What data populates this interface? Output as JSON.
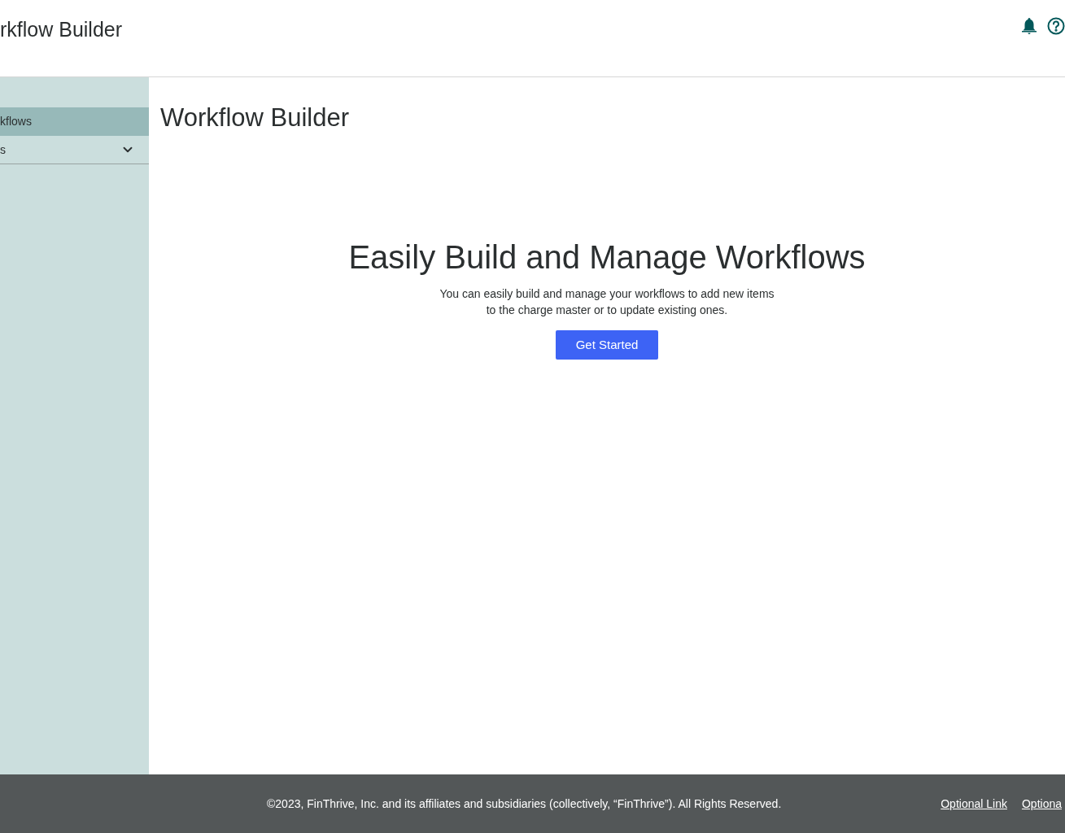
{
  "header": {
    "title": "rkflow Builder"
  },
  "sidebar": {
    "items": [
      {
        "label": "kflows",
        "selected": true,
        "expandable": false
      },
      {
        "label": "s",
        "selected": false,
        "expandable": true
      }
    ]
  },
  "main": {
    "title": "Workflow Builder",
    "hero": {
      "heading": "Easily Build and Manage Workflows",
      "description": [
        "You can easily build and manage your workflows to add new items",
        "to the charge master or to update existing ones."
      ],
      "button": "Get Started"
    }
  },
  "footer": {
    "copyright": "©2023, FinThrive, Inc. and its affiliates and subsidiaries (collectively, “FinThrive”). All Rights Reserved.",
    "links": [
      "Optional Link",
      "Optiona"
    ]
  }
}
